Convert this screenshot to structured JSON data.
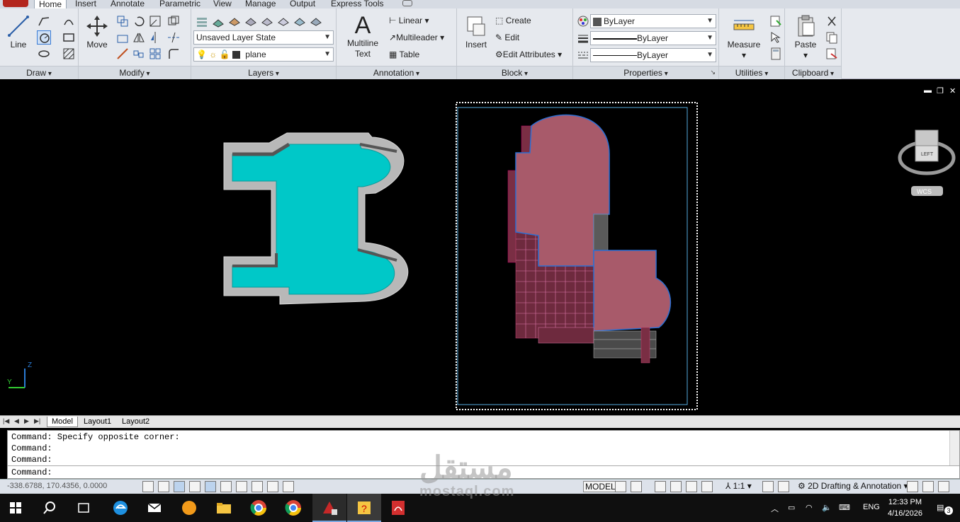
{
  "ribbon_tabs": [
    "Home",
    "Insert",
    "Annotate",
    "Parametric",
    "View",
    "Manage",
    "Output",
    "Express Tools"
  ],
  "draw": {
    "line": "Line",
    "title": "Draw"
  },
  "modify": {
    "move": "Move",
    "title": "Modify"
  },
  "layers": {
    "state": "Unsaved Layer State",
    "current": "plane",
    "title": "Layers"
  },
  "annotation": {
    "text_line1": "Multiline",
    "text_line2": "Text",
    "linear": "Linear",
    "multileader": "Multileader",
    "table": "Table",
    "title": "Annotation"
  },
  "block": {
    "insert": "Insert",
    "create": "Create",
    "edit": "Edit",
    "edit_attributes": "Edit Attributes",
    "title": "Block"
  },
  "properties": {
    "color": "ByLayer",
    "lineweight": "ByLayer",
    "linetype": "ByLayer",
    "title": "Properties"
  },
  "utilities": {
    "measure": "Measure",
    "title": "Utilities"
  },
  "clipboard": {
    "paste": "Paste",
    "title": "Clipboard"
  },
  "viewcube": {
    "face": "LEFT",
    "wcs": "WCS"
  },
  "ucs": {
    "y": "Y",
    "z": "Z"
  },
  "layout_tabs": [
    "Model",
    "Layout1",
    "Layout2"
  ],
  "command": {
    "history": [
      "Command: Specify opposite corner:",
      "Command:",
      "Command:"
    ],
    "prompt": "Command:"
  },
  "status": {
    "coords": "-338.6788, 170.4356, 0.0000",
    "model": "MODEL",
    "scale": "1:1",
    "workspace": "2D Drafting & Annotation"
  },
  "taskbar": {
    "lang": "ENG",
    "time": "12:33 PM",
    "date": "4/16/2026",
    "notifications": "3"
  },
  "watermark": {
    "arabic": "مستقل",
    "latin": "mostaql.com"
  },
  "colors": {
    "pool_fill": "#00c8c8",
    "building_fill": "#a85a6a",
    "ribbon_bg": "#e6e9ee",
    "canvas_bg": "#000000"
  }
}
